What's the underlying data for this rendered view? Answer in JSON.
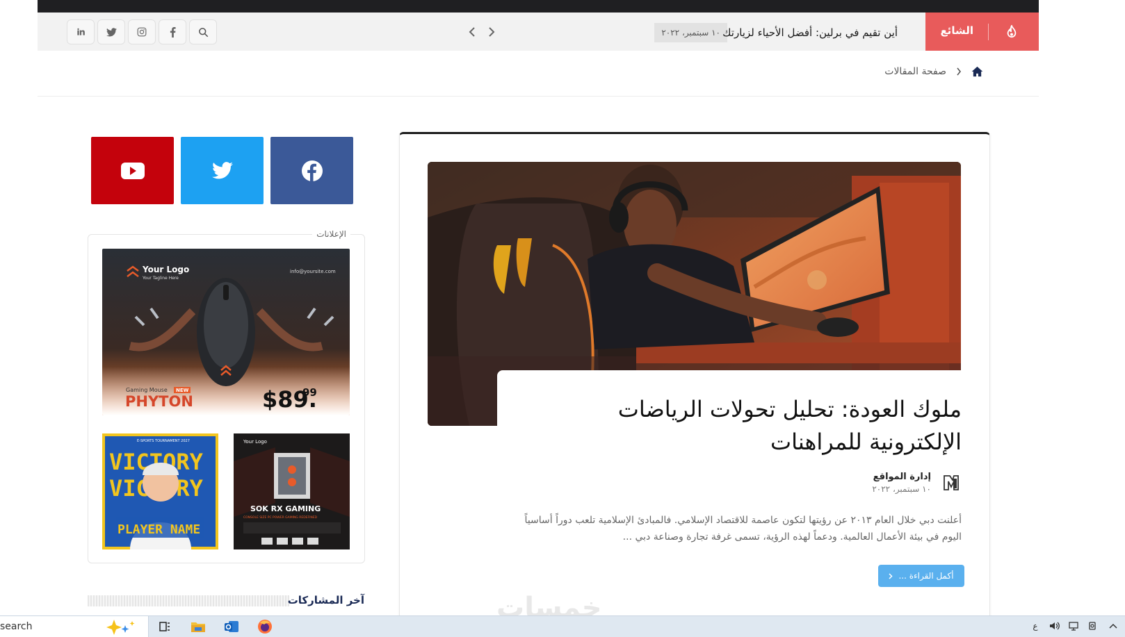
{
  "header": {
    "trending_label": "الشائع",
    "ticker_title": "أين تقيم في برلين: أفضل الأحياء لزيارتك",
    "ticker_date": "١٠ سبتمبر، ٢٠٢٢"
  },
  "breadcrumb": {
    "current": "صفحة المقالات"
  },
  "article": {
    "title": "ملوك العودة: تحليل تحولات الرياضات الإلكترونية للمراهنات",
    "author": "إدارة المواقع",
    "date": "١٠ سبتمبر، ٢٠٢٢",
    "excerpt": "أعلنت دبي خلال العام ٢٠١٣ عن رؤيتها لتكون عاصمة للاقتصاد الإسلامي. فالمبادئ الإسلامية تلعب دوراً أساسياً اليوم في بيئة الأعمال العالمية. ودعماً لهذه الرؤية، تسمى غرفة تجارة وصناعة دبي ...",
    "read_more": "أكمل القراءة ..."
  },
  "sidebar": {
    "ads_label": "الإعلانات",
    "ad_main": {
      "logo": "Your Logo",
      "tagline": "Your Tagline Here",
      "site": "info@yoursite.com",
      "small_label": "Gaming Mouse",
      "badge": "NEW",
      "product": "PHYTON",
      "price": "$89.",
      "cents": "99"
    },
    "ad_small1": {
      "kicker": "E-SPORTS TOURNAMENT 2027",
      "word": "VICTORY",
      "player": "PLAYER NAME"
    },
    "ad_small2": {
      "logo": "Your Logo",
      "title": "SOK RX GAMING",
      "subtitle": "CONSOLE SIZE PC POWER GAMING REDEFINED"
    },
    "latest_posts": "آخر المشاركات"
  },
  "watermark": "خمسات",
  "taskbar": {
    "search_text": "search",
    "tray_lang": "ع"
  },
  "colors": {
    "trending_red": "#e85b5b",
    "facebook": "#3b5998",
    "twitter": "#1da1f2",
    "youtube": "#c4020c",
    "read_more_blue": "#5ab0ee"
  }
}
